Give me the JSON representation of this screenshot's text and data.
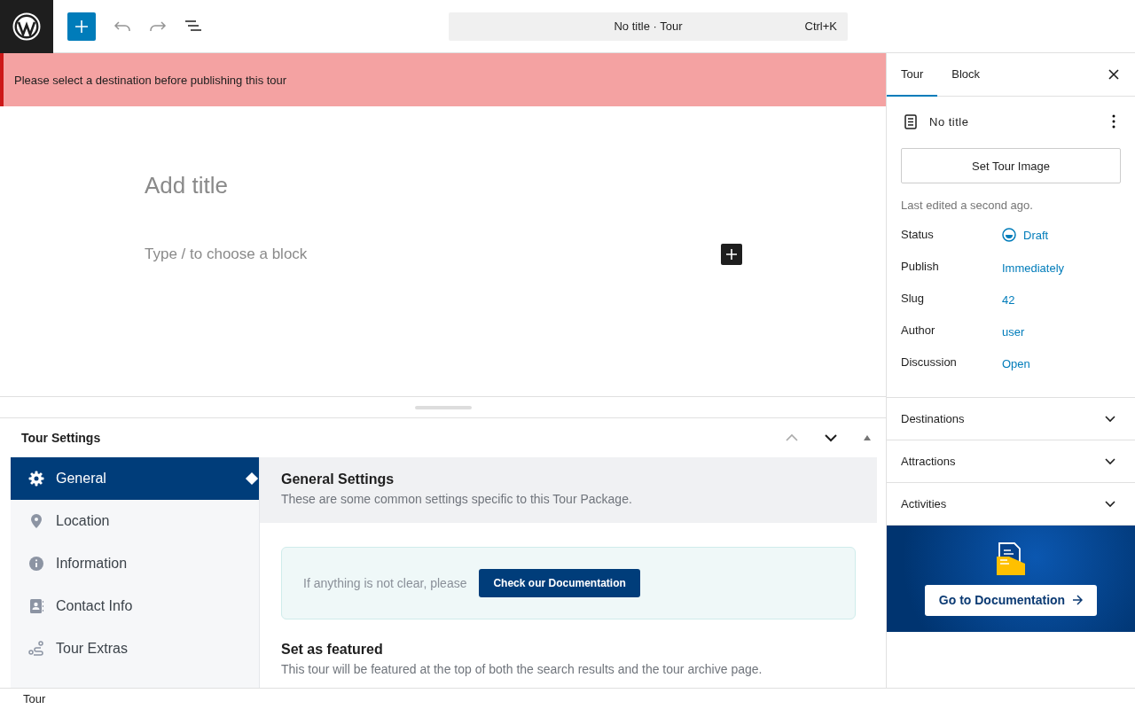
{
  "toolbar": {
    "document_title": "No title · Tour",
    "shortcut": "Ctrl+K"
  },
  "notice": {
    "message": "Please select a destination before publishing this tour"
  },
  "editor": {
    "title_placeholder": "Add title",
    "block_placeholder": "Type / to choose a block"
  },
  "tour_settings": {
    "title": "Tour Settings",
    "nav": [
      {
        "label": "General",
        "selected": true
      },
      {
        "label": "Location",
        "selected": false
      },
      {
        "label": "Information",
        "selected": false
      },
      {
        "label": "Contact Info",
        "selected": false
      },
      {
        "label": "Tour Extras",
        "selected": false
      }
    ],
    "section_title": "General Settings",
    "section_subtitle": "These are some common settings specific to this Tour Package.",
    "help_text": "If anything is not clear, please",
    "help_button": "Check our Documentation",
    "featured_title": "Set as featured",
    "featured_text": "This tour will be featured at the top of both the search results and the tour archive page."
  },
  "sidebar": {
    "tabs": [
      {
        "label": "Tour",
        "selected": true
      },
      {
        "label": "Block",
        "selected": false
      }
    ],
    "post_title": "No title",
    "image_button": "Set Tour Image",
    "last_edited": "Last edited a second ago.",
    "fields": [
      {
        "label": "Status",
        "value": "Draft",
        "kind": "status"
      },
      {
        "label": "Publish",
        "value": "Immediately",
        "kind": "link"
      },
      {
        "label": "Slug",
        "value": "42",
        "kind": "link"
      },
      {
        "label": "Author",
        "value": "user",
        "kind": "link"
      },
      {
        "label": "Discussion",
        "value": "Open",
        "kind": "link"
      }
    ],
    "panels": [
      {
        "title": "Destinations",
        "expanded": false
      },
      {
        "title": "Attractions",
        "expanded": false
      },
      {
        "title": "Activities",
        "expanded": false
      }
    ],
    "promo_button": "Go to Documentation"
  },
  "status_bar": {
    "breadcrumb": "Tour"
  }
}
